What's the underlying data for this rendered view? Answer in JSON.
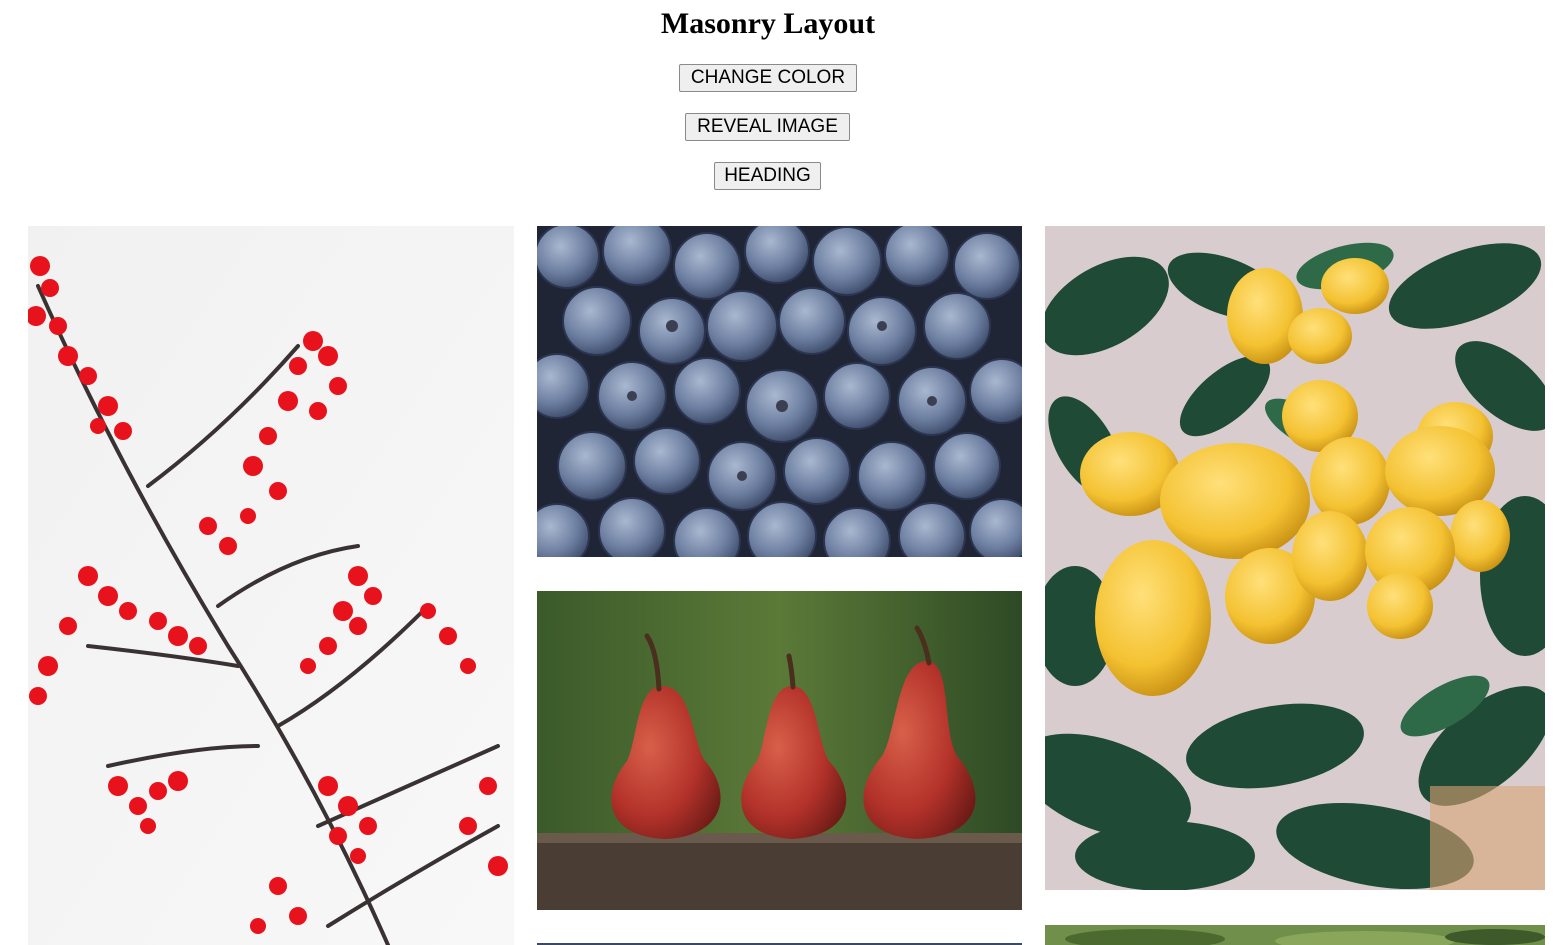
{
  "page": {
    "title": "Masonry Layout"
  },
  "buttons": {
    "change_color": "CHANGE COLOR",
    "reveal_image": "REVEAL IMAGE",
    "heading": "HEADING"
  },
  "gallery": {
    "images": [
      {
        "subject": "red-berries-branch",
        "accent": "#e0141f"
      },
      {
        "subject": "blueberries",
        "accent": "#5f7194"
      },
      {
        "subject": "pears-on-log",
        "accent": "#b8352a"
      },
      {
        "subject": "lemon-tree",
        "accent": "#f4c232"
      },
      {
        "subject": "partial-image-bottom-middle",
        "accent": "#3b4a63"
      },
      {
        "subject": "partial-image-bottom-right",
        "accent": "#6f8f4a"
      }
    ]
  }
}
